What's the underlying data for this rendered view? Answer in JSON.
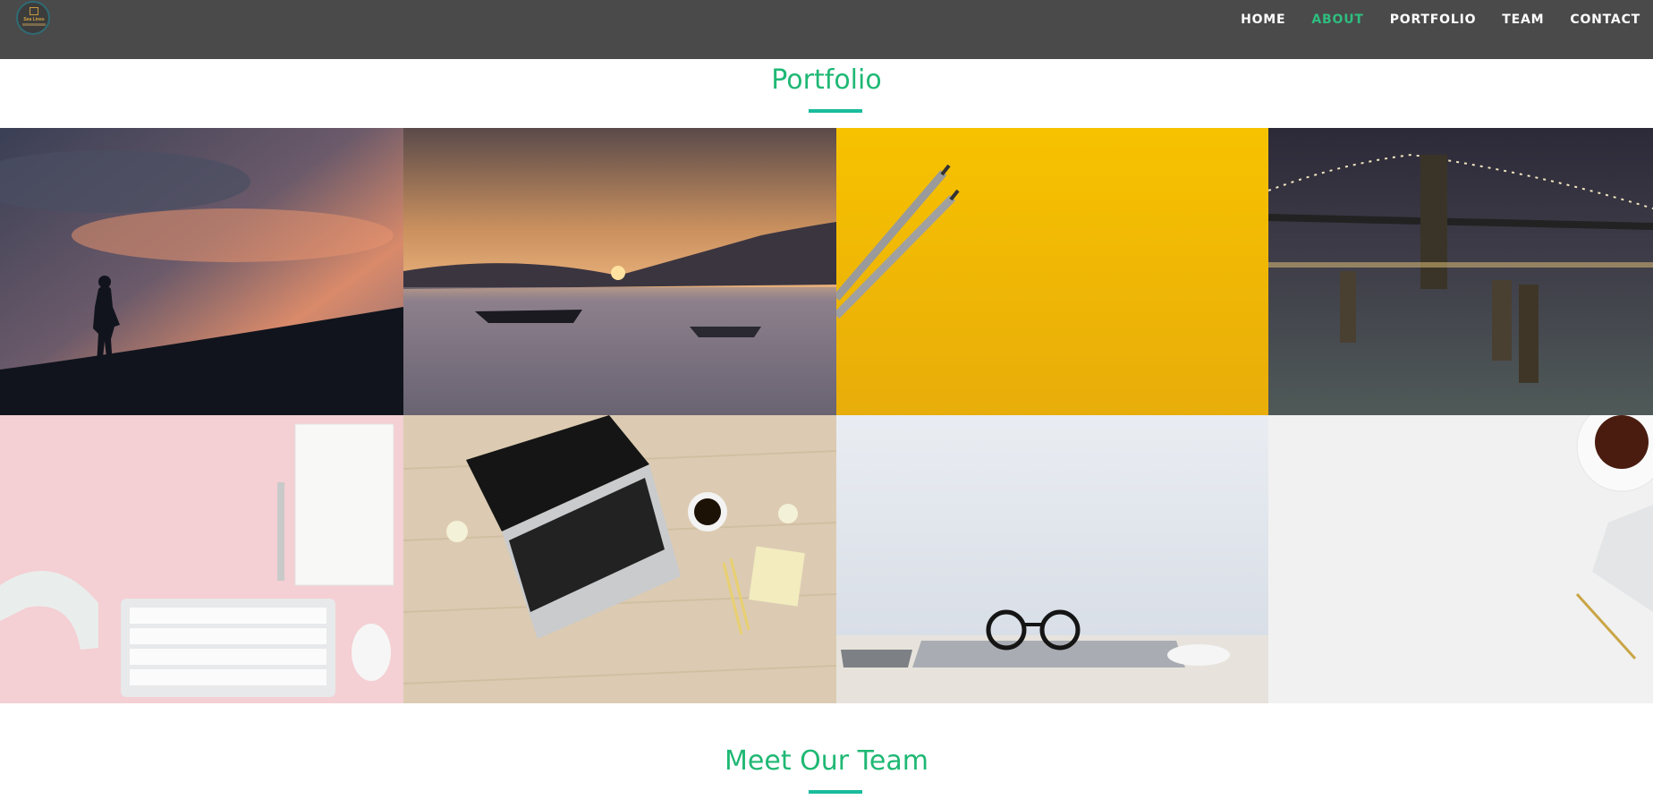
{
  "brand": {
    "logo_text": "Sea Lines"
  },
  "nav": {
    "items": [
      {
        "label": "HOME",
        "active": false
      },
      {
        "label": "ABOUT",
        "active": true
      },
      {
        "label": "PORTFOLIO",
        "active": false
      },
      {
        "label": "TEAM",
        "active": false
      },
      {
        "label": "CONTACT",
        "active": false
      }
    ]
  },
  "portfolio": {
    "title": "Portfolio",
    "images": [
      {
        "subject": "person-silhouette-sunset"
      },
      {
        "subject": "boats-frozen-lake-sunrise"
      },
      {
        "subject": "pencils-on-yellow"
      },
      {
        "subject": "bridge-at-night"
      },
      {
        "subject": "desk-headphones-keyboard-pink"
      },
      {
        "subject": "laptop-on-wooden-desk"
      },
      {
        "subject": "glasses-on-laptop"
      },
      {
        "subject": "coffee-and-keyboard-white"
      }
    ]
  },
  "team": {
    "title": "Meet Our Team"
  },
  "colors": {
    "accent": "#1fb874",
    "navbar": "#4a4a4a",
    "underline": "#1abc9c"
  }
}
